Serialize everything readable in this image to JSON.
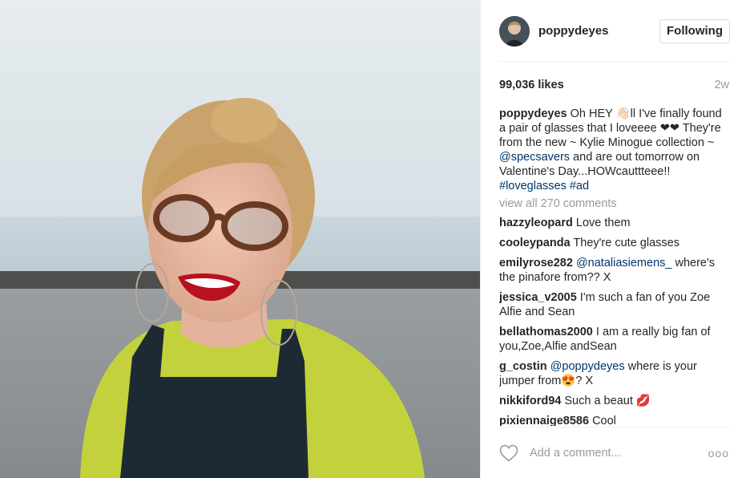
{
  "post": {
    "author": {
      "username": "poppydeyes",
      "follow_label": "Following"
    },
    "likes": "99,036 likes",
    "time_ago": "2w",
    "caption": {
      "username": "poppydeyes",
      "text_1": "Oh HEY ",
      "emoji_wave": "👋🏻",
      "text_2": "ll I've finally found a pair of glasses that I loveeee ",
      "emoji_hearts": "❤❤",
      "text_3": " They're from the new ~ Kylie Minogue collection ~ ",
      "mention": "@specsavers",
      "text_4": " and are out tomorrow on Valentine's Day...HOWcauttteee!! ",
      "tag_1": "#loveglasses",
      "tag_2": "#ad"
    },
    "view_all_comments": "view all 270 comments",
    "comments": [
      {
        "user": "hazzyleopard",
        "text": "Love them"
      },
      {
        "user": "cooleypanda",
        "text": "They're cute glasses"
      },
      {
        "user": "emilyrose282",
        "mention": "@nataliasiemens_",
        "text": "where's the pinafore from?? X"
      },
      {
        "user": "jessica_v2005",
        "text": "I'm such a fan of you Zoe Alfie and Sean"
      },
      {
        "user": "bellathomas2000",
        "text": "I am a really big fan of you,Zoe,Alfie andSean"
      },
      {
        "user": "g_costin",
        "mention": "@poppydeyes",
        "text": "where is your jumper from",
        "emoji": "😍",
        "text_after": "? X"
      },
      {
        "user": "nikkiford94",
        "text": "Such a beaut",
        "emoji": "💋"
      },
      {
        "user": "pixiennaige8586",
        "text": "Cool"
      }
    ],
    "add_comment_placeholder": "Add a comment...",
    "more_options": "ooo"
  },
  "icons": {
    "like": "heart-outline-icon",
    "options": "more-options-icon"
  },
  "colors": {
    "link": "#003569",
    "muted": "#999999",
    "text": "#262626",
    "border": "#efefef"
  }
}
